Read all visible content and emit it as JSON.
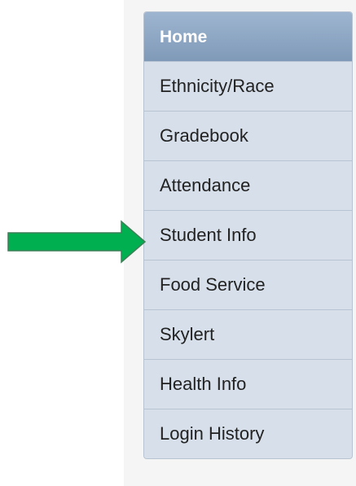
{
  "menu": {
    "items": [
      {
        "label": "Home",
        "active": true
      },
      {
        "label": "Ethnicity/Race"
      },
      {
        "label": "Gradebook"
      },
      {
        "label": "Attendance"
      },
      {
        "label": "Student Info"
      },
      {
        "label": "Food Service"
      },
      {
        "label": "Skylert"
      },
      {
        "label": "Health Info"
      },
      {
        "label": "Login History"
      }
    ]
  },
  "annotation": {
    "arrow_color": "#00b050",
    "arrow_icon": "arrow-right-icon"
  },
  "colors": {
    "active_item": "#8aa4c2",
    "menu_item": "#d6dfea",
    "menu_border": "#b8c4d1"
  }
}
